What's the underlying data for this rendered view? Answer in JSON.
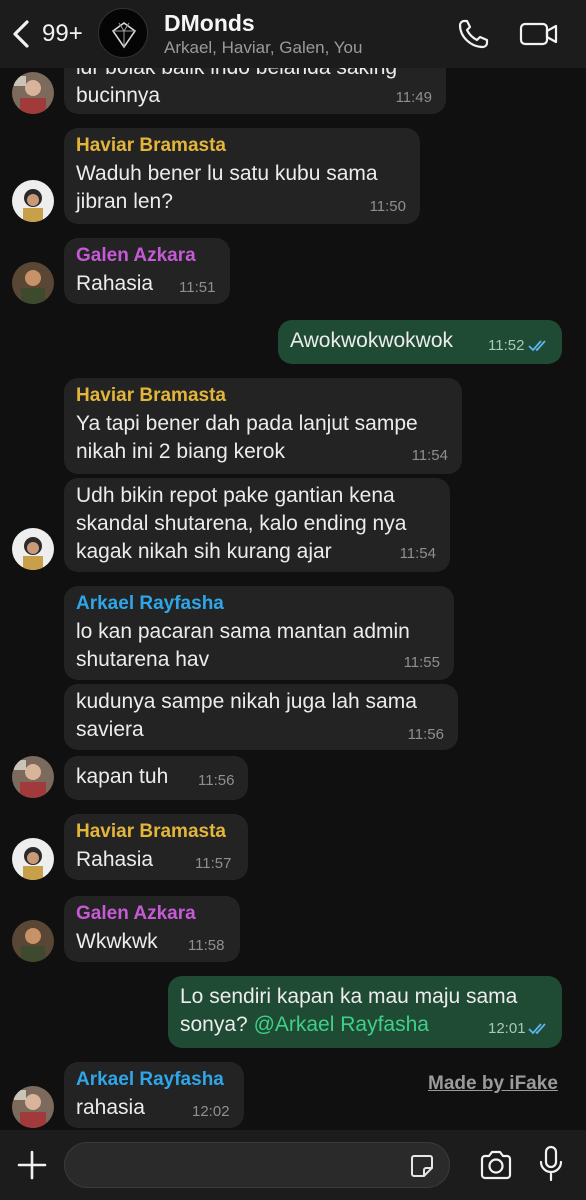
{
  "header": {
    "back_count": "99+",
    "group_name": "DMonds",
    "members": "Arkael, Haviar, Galen, You",
    "icons": [
      "chevron-left-icon",
      "phone-icon",
      "video-icon"
    ]
  },
  "colors": {
    "haviar": "#e3b53b",
    "galen": "#c65ad6",
    "arkael": "#2fa6e8",
    "outgoing_bubble": "#1f4a34",
    "incoming_bubble": "#232323"
  },
  "messages": [
    {
      "id": "m1",
      "text": "idr bolak balik indo belanda saking\nbucinnya",
      "time": "11:49"
    },
    {
      "id": "m2",
      "sender": "Haviar Bramasta",
      "text": "Waduh bener lu satu kubu sama\njibran len?",
      "time": "11:50"
    },
    {
      "id": "m3",
      "sender": "Galen Azkara",
      "text": "Rahasia",
      "time": "11:51"
    },
    {
      "id": "m4",
      "text": "Awokwokwokwok",
      "time": "11:52",
      "outgoing": true
    },
    {
      "id": "m5",
      "sender": "Haviar Bramasta",
      "text": "Ya tapi bener dah pada lanjut sampe\nnikah ini 2 biang kerok",
      "time": "11:54"
    },
    {
      "id": "m6",
      "text": "Udh bikin repot pake gantian kena\nskandal shutarena, kalo ending nya\nkagak nikah sih kurang ajar",
      "time": "11:54"
    },
    {
      "id": "m7",
      "sender": "Arkael Rayfasha",
      "text": "lo kan pacaran sama mantan admin\nshutarena hav",
      "time": "11:55"
    },
    {
      "id": "m8",
      "text": "kudunya sampe nikah juga lah sama\nsaviera",
      "time": "11:56"
    },
    {
      "id": "m9",
      "text": "kapan tuh",
      "time": "11:56"
    },
    {
      "id": "m10",
      "sender": "Haviar Bramasta",
      "text": "Rahasia",
      "time": "11:57"
    },
    {
      "id": "m11",
      "sender": "Galen Azkara",
      "text": "Wkwkwk",
      "time": "11:58"
    },
    {
      "id": "m12",
      "text_line1": "Lo sendiri kapan ka mau maju sama",
      "text_line2": "sonya? ",
      "mention": "@Arkael Rayfasha",
      "time": "12:01",
      "outgoing": true
    },
    {
      "id": "m13",
      "sender": "Arkael Rayfasha",
      "text": "rahasia",
      "time": "12:02"
    }
  ],
  "watermark": "Made by iFake",
  "footer": {
    "input_value": "",
    "icons": [
      "plus-icon",
      "sticker-icon",
      "camera-icon",
      "microphone-icon"
    ]
  }
}
